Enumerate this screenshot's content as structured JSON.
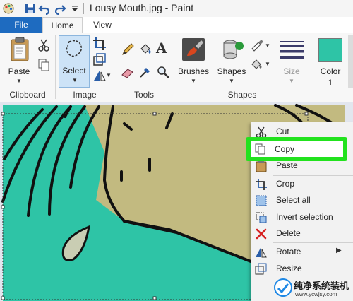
{
  "window": {
    "title": "Lousy Mouth.jpg - Paint"
  },
  "tabs": {
    "file": "File",
    "home": "Home",
    "view": "View"
  },
  "ribbon": {
    "clipboard": {
      "paste_label": "Paste",
      "group_label": "Clipboard"
    },
    "image": {
      "select_label": "Select",
      "group_label": "Image"
    },
    "tools": {
      "group_label": "Tools",
      "text_tool": "A"
    },
    "brushes": {
      "label": "Brushes"
    },
    "shapes": {
      "label": "Shapes",
      "group_label": "Shapes"
    },
    "size": {
      "label": "Size"
    },
    "color1": {
      "label": "Color",
      "number": "1",
      "swatch": "#2ec4a6"
    }
  },
  "canvas": {
    "teal": "#2ec4a6",
    "tan": "#c2ba80"
  },
  "context_menu": {
    "items": [
      {
        "label": "Cut"
      },
      {
        "label": "Copy"
      },
      {
        "label": "Paste"
      },
      {
        "label": "Crop"
      },
      {
        "label": "Select all"
      },
      {
        "label": "Invert selection"
      },
      {
        "label": "Delete"
      },
      {
        "label": "Rotate"
      },
      {
        "label": "Resize"
      }
    ],
    "highlight_color": "#22e21e"
  },
  "watermark": {
    "text": "纯净系统装机",
    "url": "www.ycwjsy.com"
  }
}
